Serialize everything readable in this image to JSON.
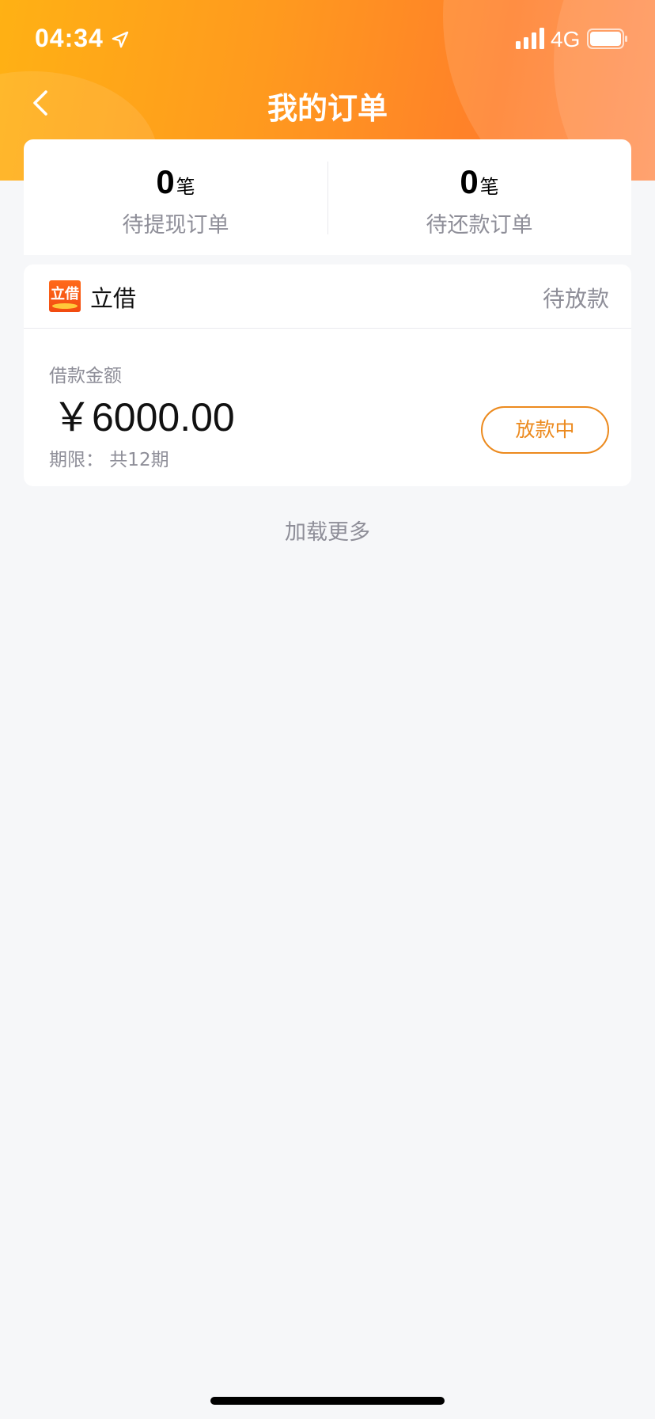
{
  "status_bar": {
    "time": "04:34",
    "network": "4G",
    "icons": [
      "location-arrow-icon",
      "signal-icon",
      "battery-icon"
    ]
  },
  "nav": {
    "title": "我的订单",
    "back_icon": "chevron-left-icon"
  },
  "summary": [
    {
      "count": "0",
      "unit": "笔",
      "label": "待提现订单"
    },
    {
      "count": "0",
      "unit": "笔",
      "label": "待还款订单"
    }
  ],
  "order": {
    "brand_logo_text": "立借",
    "brand_name": "立借",
    "status": "待放款",
    "amount_label": "借款金额",
    "amount": "￥6000.00",
    "term": "期限：  共12期",
    "action_label": "放款中"
  },
  "load_more": "加载更多",
  "colors": {
    "accent": "#ff8a1e",
    "button_orange": "#ec8a1e",
    "muted_text": "#8e8e98",
    "background": "#f6f7f9"
  }
}
